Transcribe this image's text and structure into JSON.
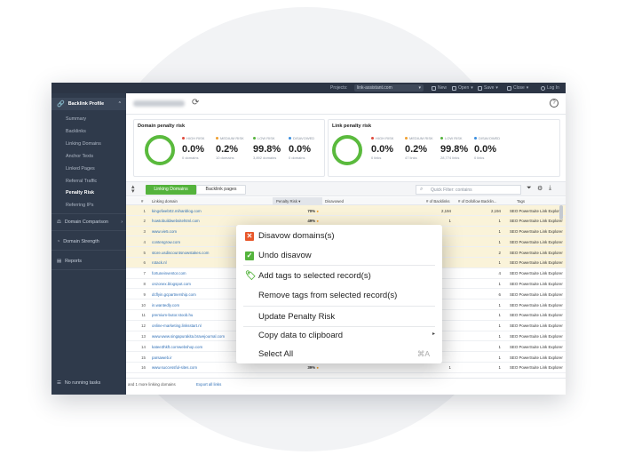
{
  "topbar": {
    "projects_label": "Projects:",
    "project_value": "link-assistant.com",
    "new_label": "New",
    "open_label": "Open",
    "save_label": "Save",
    "close_label": "Close",
    "login_label": "Log In"
  },
  "sidebar": {
    "active_section": "Backlink Profile",
    "sub_items": [
      "Summary",
      "Backlinks",
      "Linking Domains",
      "Anchor Texts",
      "Linked Pages",
      "Referral Traffic",
      "Penalty Risk",
      "Referring IPs"
    ],
    "active_item": "Penalty Risk",
    "sections": [
      "Domain Comparison",
      "Domain Strength",
      "Reports"
    ],
    "bottom_status": "No running tasks"
  },
  "urlbar": {
    "blurred_url": "link-assistant.com"
  },
  "domain_card": {
    "title": "Domain penalty risk",
    "metrics": [
      {
        "label": "HIGH RISK",
        "value": "0.0%",
        "sub": "0 domains",
        "color": "#e04a3c"
      },
      {
        "label": "MEDIUM RISK",
        "value": "0.2%",
        "sub": "10 domains",
        "color": "#f0a030"
      },
      {
        "label": "LOW RISK",
        "value": "99.8%",
        "sub": "3,892 domains",
        "color": "#54b33c"
      },
      {
        "label": "DISAVOWED",
        "value": "0.0%",
        "sub": "0 domains",
        "color": "#3a8ee0"
      }
    ]
  },
  "link_card": {
    "title": "Link penalty risk",
    "metrics": [
      {
        "label": "HIGH RISK",
        "value": "0.0%",
        "sub": "0 links",
        "color": "#e04a3c"
      },
      {
        "label": "MEDIUM RISK",
        "value": "0.2%",
        "sub": "47 links",
        "color": "#f0a030"
      },
      {
        "label": "LOW RISK",
        "value": "99.8%",
        "sub": "28,774 links",
        "color": "#54b33c"
      },
      {
        "label": "DISAVOWED",
        "value": "0.0%",
        "sub": "0 links",
        "color": "#3a8ee0"
      }
    ]
  },
  "tabs": {
    "active": "Linking Domains",
    "inactive": "Backlink pages"
  },
  "filter": {
    "placeholder": "Quick Filter: contains"
  },
  "table": {
    "headers": {
      "num": "#",
      "domain": "Linking domain",
      "risk": "Penalty Risk",
      "disavowed": "Disavowed",
      "backlinks": "# of Backlinks",
      "dofollow": "# of Dofollow Backlin...",
      "tags": "Tags"
    },
    "rows": [
      {
        "num": "1",
        "domain": "kingofweb02.mihanblog.com",
        "risk": "70%",
        "backlinks": "2,194",
        "dofollow": "2,194",
        "tags": "SEO PowerSuite Link Explorer",
        "hl": true
      },
      {
        "num": "2",
        "domain": "howtobuildwebsitehtml.com",
        "risk": "49%",
        "backlinks": "1",
        "dofollow": "1",
        "tags": "SEO PowerSuite Link Explorer",
        "hl": true
      },
      {
        "num": "3",
        "domain": "www.vie5.com",
        "risk": "",
        "backlinks": "",
        "dofollow": "1",
        "tags": "SEO PowerSuite Link Explorer",
        "hl": true
      },
      {
        "num": "4",
        "domain": "contengrow.com",
        "risk": "",
        "backlinks": "",
        "dofollow": "1",
        "tags": "SEO PowerSuite Link Explorer",
        "hl": true
      },
      {
        "num": "5",
        "domain": "store.usdiscountsnowstakes.com",
        "risk": "",
        "backlinks": "",
        "dofollow": "2",
        "tags": "SEO PowerSuite Link Explorer",
        "hl": true
      },
      {
        "num": "6",
        "domain": "rotack.nl",
        "risk": "",
        "backlinks": "",
        "dofollow": "1",
        "tags": "SEO PowerSuite Link Explorer",
        "hl": true
      },
      {
        "num": "7",
        "domain": "fortuneinventor.com",
        "risk": "",
        "backlinks": "",
        "dofollow": "4",
        "tags": "SEO PowerSuite Link Explorer",
        "hl": false
      },
      {
        "num": "8",
        "domain": "onzonex.blogspot.com",
        "risk": "",
        "backlinks": "",
        "dofollow": "1",
        "tags": "SEO PowerSuite Link Explorer",
        "hl": false
      },
      {
        "num": "9",
        "domain": "dcflyin.gcpartnership.com",
        "risk": "",
        "backlinks": "",
        "dofollow": "6",
        "tags": "SEO PowerSuite Link Explorer",
        "hl": false
      },
      {
        "num": "10",
        "domain": "in.wantedly.com",
        "risk": "",
        "backlinks": "",
        "dofollow": "1",
        "tags": "SEO PowerSuite Link Explorer",
        "hl": false
      },
      {
        "num": "11",
        "domain": "premium-butor.stoob.hu",
        "risk": "",
        "backlinks": "",
        "dofollow": "1",
        "tags": "SEO PowerSuite Link Explorer",
        "hl": false
      },
      {
        "num": "12",
        "domain": "online-marketing.linksstart.nl",
        "risk": "",
        "backlinks": "",
        "dofollow": "1",
        "tags": "SEO PowerSuite Link Explorer",
        "hl": false
      },
      {
        "num": "13",
        "domain": "www.www.singapurakita.bravejournal.com",
        "risk": "",
        "backlinks": "",
        "dofollow": "1",
        "tags": "SEO PowerSuite Link Explorer",
        "hl": false
      },
      {
        "num": "14",
        "domain": "katee3hkft.cornwebshop.com",
        "risk": "",
        "backlinks": "",
        "dofollow": "1",
        "tags": "SEO PowerSuite Link Explorer",
        "hl": false
      },
      {
        "num": "15",
        "domain": "parsaweb.ir",
        "risk": "",
        "backlinks": "",
        "dofollow": "1",
        "tags": "SEO PowerSuite Link Explorer",
        "hl": false
      },
      {
        "num": "16",
        "domain": "www.successful-sites.com",
        "risk": "39%",
        "backlinks": "1",
        "dofollow": "1",
        "tags": "SEO PowerSuite Link Explorer",
        "hl": false
      }
    ]
  },
  "footer": {
    "more_text": "and 1 more linking domains",
    "export_link": "Export all links"
  },
  "context_menu": {
    "items": [
      {
        "label": "Disavow domains(s)",
        "icon": "disavow-icon",
        "color": "#e8572a"
      },
      {
        "label": "Undo disavow",
        "icon": "checkbox-icon",
        "color": "#54b33c"
      },
      {
        "label": "Add tags to selected record(s)",
        "icon": "tag-icon",
        "color": "#54b33c"
      },
      {
        "label": "Remove tags from selected record(s)"
      },
      {
        "label": "Update Penalty Risk"
      },
      {
        "label": "Copy data to clipboard"
      },
      {
        "label": "Select All",
        "shortcut": "⌘A"
      }
    ]
  }
}
